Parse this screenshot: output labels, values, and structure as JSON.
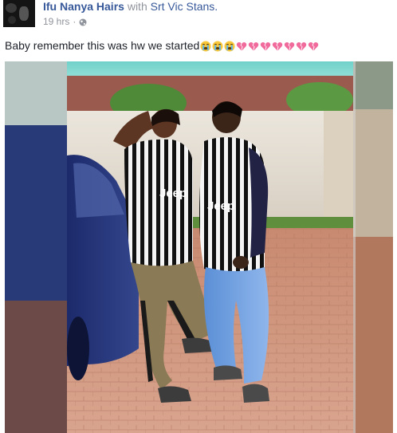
{
  "post": {
    "author": "Ifu Nanya Hairs",
    "with_text": "with",
    "tagged": "Srt Vic Stans.",
    "timestamp": "19 hrs",
    "separator": "·",
    "privacy_icon": "globe-icon",
    "text": "Baby remember this was hw we started",
    "emojis": [
      "crying-face",
      "crying-face",
      "crying-face",
      "broken-heart",
      "broken-heart",
      "broken-heart",
      "broken-heart",
      "broken-heart",
      "broken-heart",
      "broken-heart"
    ]
  },
  "photo": {
    "shirt_text_left": "Jeep",
    "shirt_text_right": "Jeep"
  },
  "colors": {
    "link": "#365899",
    "meta": "#90949c",
    "text": "#1d2129",
    "broken_heart": "#f06a9b"
  }
}
